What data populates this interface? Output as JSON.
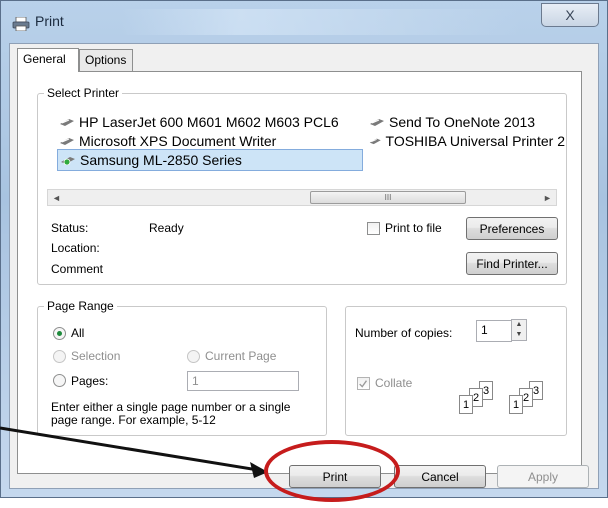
{
  "window": {
    "title": "Print",
    "close_glyph": "X"
  },
  "tabs": [
    {
      "label": "General"
    },
    {
      "label": "Options"
    }
  ],
  "select_printer": {
    "label": "Select Printer",
    "printers": [
      {
        "name": "HP LaserJet 600 M601 M602 M603 PCL6",
        "selected": false
      },
      {
        "name": "Send To OneNote 2013",
        "selected": false
      },
      {
        "name": "Microsoft XPS Document Writer",
        "selected": false
      },
      {
        "name": "TOSHIBA Universal Printer 2",
        "selected": false
      },
      {
        "name": "Samsung ML-2850 Series",
        "selected": true
      }
    ],
    "scroll_left": "◄",
    "scroll_thumb": "III",
    "scroll_right": "►"
  },
  "status": {
    "status_label": "Status:",
    "status_value": "Ready",
    "location_label": "Location:",
    "location_value": "",
    "comment_label": "Comment",
    "comment_value": ""
  },
  "print_to_file": {
    "label": "Print to file",
    "checked": false
  },
  "preferences_button": "Preferences",
  "find_printer_button": "Find Printer...",
  "page_range": {
    "label": "Page Range",
    "all_label": "All",
    "selection_label": "Selection",
    "current_page_label": "Current Page",
    "pages_label": "Pages:",
    "pages_value": "1",
    "hint": "Enter either a single page number or a single page range.  For example, 5-12",
    "selected": "All"
  },
  "copies": {
    "label": "Number of copies:",
    "value": "1",
    "spin_up": "▲",
    "spin_down": "▼",
    "collate_label": "Collate",
    "collate_checked": true,
    "collate_pages": [
      "1",
      "2",
      "3"
    ]
  },
  "buttons": {
    "print": "Print",
    "cancel": "Cancel",
    "apply": "Apply"
  },
  "colors": {
    "annotation": "#c61c1c",
    "arrow": "#111111",
    "selected_row": "#cde4f7"
  }
}
